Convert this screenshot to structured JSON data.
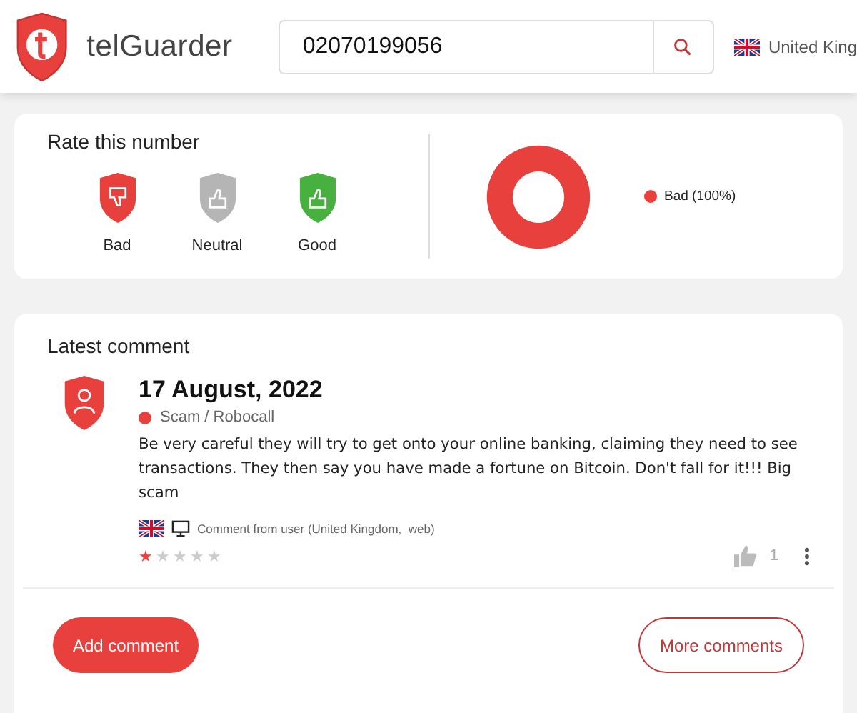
{
  "header": {
    "brand": "telGuarder",
    "search": {
      "value": "02070199056"
    },
    "country": "United King"
  },
  "rating": {
    "title": "Rate this number",
    "options": [
      {
        "label": "Bad",
        "kind": "bad",
        "color": "#e8403c"
      },
      {
        "label": "Neutral",
        "kind": "neutral",
        "color": "#b5b5b5"
      },
      {
        "label": "Good",
        "kind": "good",
        "color": "#47b03f"
      }
    ],
    "legend": [
      {
        "label": "Bad (100%)",
        "color": "#e8403c"
      }
    ]
  },
  "comments": {
    "title": "Latest comment",
    "items": [
      {
        "date": "17 August, 2022",
        "category": {
          "label": "Scam / Robocall",
          "color": "#e8403c"
        },
        "text": "Be very careful they will try to get onto your online banking, claiming they need to see transactions. They then say you have made a fortune on Bitcoin. Don't fall for it!!! Big scam",
        "source": "Comment from user (United Kingdom,  web)",
        "stars": 1,
        "likes": "1"
      }
    ],
    "buttons": [
      {
        "label": "Add comment",
        "kind": "primary"
      },
      {
        "label": "More comments",
        "kind": "outline"
      }
    ]
  }
}
